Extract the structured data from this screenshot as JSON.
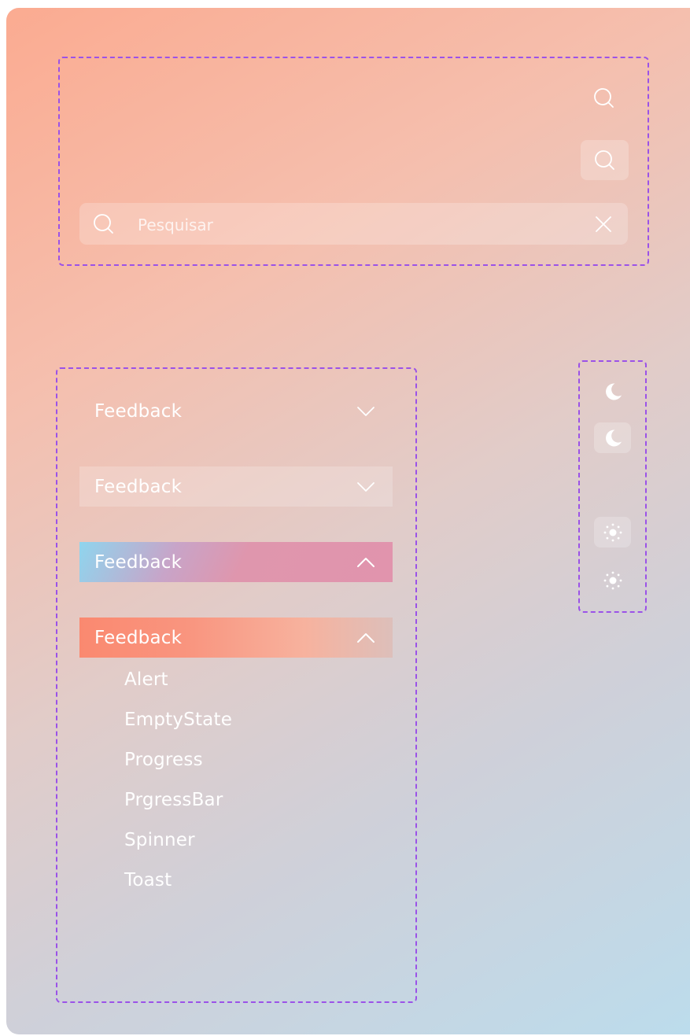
{
  "search": {
    "placeholder": "Pesquisar",
    "value": ""
  },
  "accordion": {
    "items": [
      {
        "label": "Feedback",
        "state": "collapsed",
        "variant": "plain"
      },
      {
        "label": "Feedback",
        "state": "collapsed",
        "variant": "glass"
      },
      {
        "label": "Feedback",
        "state": "expanded",
        "variant": "blue-pink-gradient"
      },
      {
        "label": "Feedback",
        "state": "expanded",
        "variant": "coral-gradient"
      }
    ],
    "sub_items": [
      "Alert",
      "EmptyState",
      "Progress",
      "PrgressBar",
      "Spinner",
      "Toast"
    ]
  },
  "theme_toggles": [
    {
      "icon": "moon-icon",
      "variant": "plain"
    },
    {
      "icon": "moon-icon",
      "variant": "glass"
    },
    {
      "icon": "sun-icon",
      "variant": "glass"
    },
    {
      "icon": "sun-icon",
      "variant": "plain"
    }
  ],
  "colors": {
    "dashed_border": "#9b52e8",
    "gradient_coral": "#fa8970",
    "gradient_pink": "#e194ad",
    "gradient_blue": "#8fd5ee",
    "background_top": "#fbab91",
    "background_bottom": "#bcdcec"
  }
}
